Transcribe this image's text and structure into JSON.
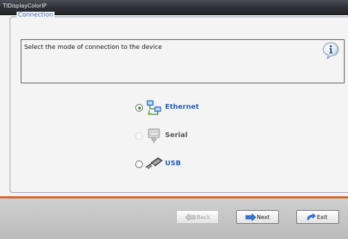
{
  "window": {
    "title": "TIDisplayColorIP"
  },
  "group": {
    "label": "Connection"
  },
  "info": {
    "message": "Select the mode of connection to the device",
    "icon": "info-icon"
  },
  "options": [
    {
      "label": "Ethernet",
      "icon": "ethernet-icon",
      "selected": true,
      "enabled": true
    },
    {
      "label": "Serial",
      "icon": "serial-port-icon",
      "selected": false,
      "enabled": false
    },
    {
      "label": "USB",
      "icon": "usb-icon",
      "selected": false,
      "enabled": true
    }
  ],
  "buttons": {
    "back": {
      "label": "Back",
      "enabled": false,
      "icon": "arrow-left-icon"
    },
    "next": {
      "label": "Next",
      "enabled": true,
      "icon": "arrow-right-icon"
    },
    "exit": {
      "label": "Exit",
      "enabled": true,
      "icon": "exit-icon"
    }
  },
  "colors": {
    "accent_line": "#e65a1a",
    "option_text": "#2b5fb0",
    "titlebar": "#2b2f35"
  }
}
